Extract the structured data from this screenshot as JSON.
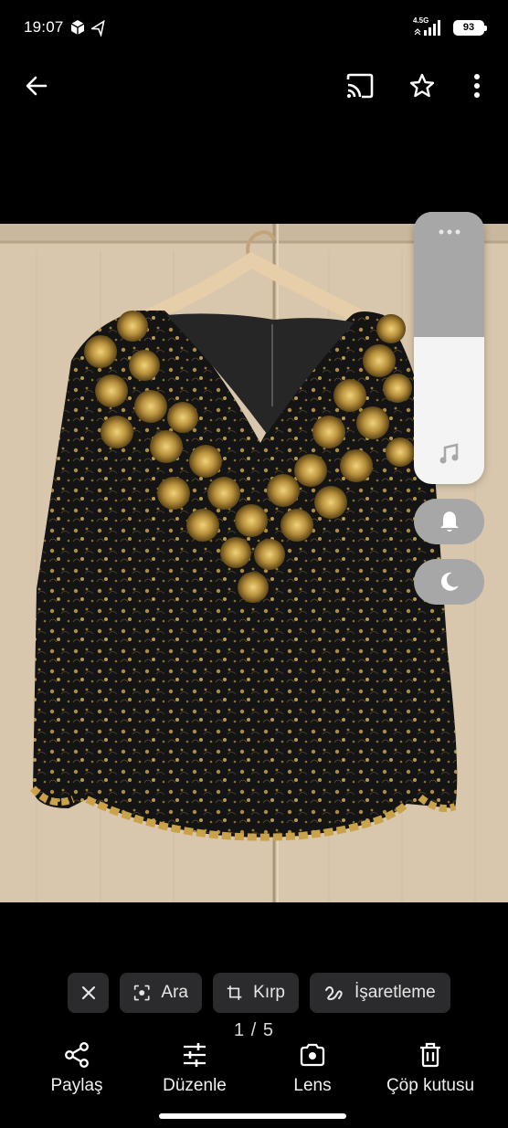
{
  "status_bar": {
    "time": "19:07",
    "network": "4.5G",
    "battery": "93"
  },
  "app_bar": {
    "back_icon": "arrow-left-icon",
    "cast_icon": "cast-icon",
    "favorite_icon": "star-outline-icon",
    "more_icon": "more-vert-icon"
  },
  "volume_panel": {
    "level": 0.64,
    "menu_icon": "more-horiz-icon",
    "music_icon": "music-note-icon",
    "ring_icon": "bell-icon",
    "dnd_icon": "moon-icon"
  },
  "chips": {
    "close_icon": "close-icon",
    "search_label": "Ara",
    "crop_label": "Kırp",
    "markup_label": "İşaretleme"
  },
  "pager": {
    "text": "1 / 5"
  },
  "actions": {
    "share": "Paylaş",
    "edit": "Düzenle",
    "lens": "Lens",
    "trash": "Çöp kutusu"
  },
  "colors": {
    "background": "#000000",
    "chip_bg": "#2b2b2d",
    "panel_light": "#f4f4f4",
    "panel_gray": "#a7a7a7",
    "sequin_gold": "#c9a24a"
  }
}
